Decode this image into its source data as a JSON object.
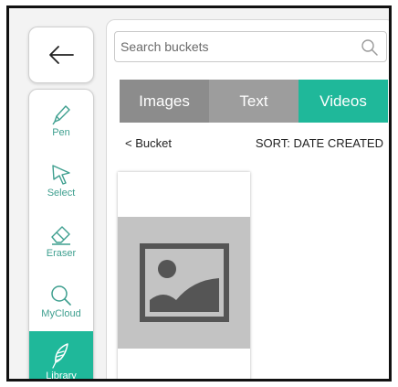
{
  "toolbar": {
    "tools": [
      {
        "id": "pen",
        "label": "Pen",
        "icon": "pen-icon"
      },
      {
        "id": "select",
        "label": "Select",
        "icon": "cursor-icon"
      },
      {
        "id": "eraser",
        "label": "Eraser",
        "icon": "eraser-icon"
      },
      {
        "id": "mycloud",
        "label": "MyCloud",
        "icon": "search-icon"
      },
      {
        "id": "library",
        "label": "Library",
        "icon": "feather-icon",
        "active": true
      }
    ]
  },
  "search": {
    "placeholder": "Search buckets",
    "value": ""
  },
  "tabs": [
    {
      "label": "Images"
    },
    {
      "label": "Text"
    },
    {
      "label": "Videos",
      "selected": true
    }
  ],
  "bucket_link": "< Bucket",
  "sort_label": "SORT: DATE CREATED",
  "colors": {
    "accent": "#1fb89a",
    "tab_gray": "#8c8c8c",
    "thumb_gray": "#c3c3c3"
  }
}
